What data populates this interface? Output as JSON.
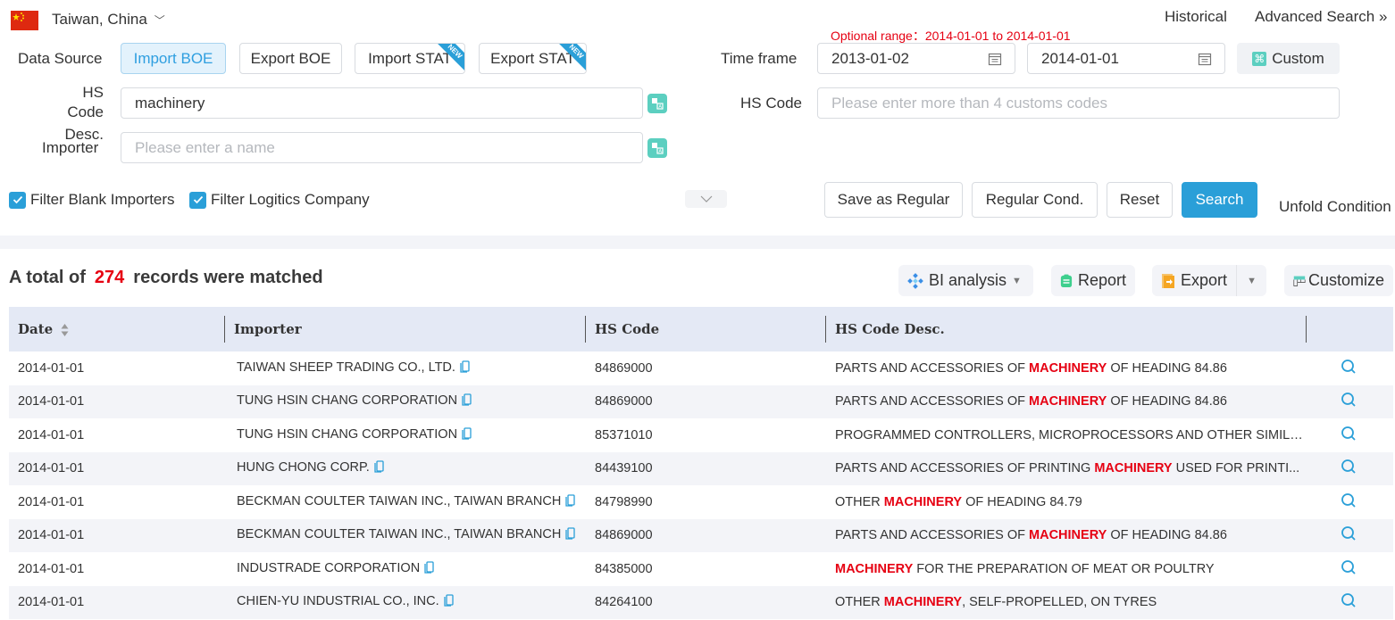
{
  "header": {
    "country": "Taiwan, China",
    "links": {
      "historical": "Historical",
      "advanced_search": "Advanced Search",
      "advanced_icon": "»"
    }
  },
  "form": {
    "data_source_label": "Data Source",
    "data_sources": [
      {
        "label": "Import BOE",
        "active": true,
        "new": false
      },
      {
        "label": "Export BOE",
        "active": false,
        "new": false
      },
      {
        "label": "Import STAT",
        "active": false,
        "new": true
      },
      {
        "label": "Export STAT",
        "active": false,
        "new": true
      }
    ],
    "new_badge": "NEW",
    "time_frame_label": "Time frame",
    "optional_range": "Optional range：2014-01-01 to 2014-01-01",
    "date_from": "2013-01-02",
    "date_to": "2014-01-01",
    "custom_label": "Custom",
    "hs_desc_label_1": "HS Code",
    "hs_desc_label_2": "Desc.",
    "hs_desc_value": "machinery",
    "hs_code_label": "HS Code",
    "hs_code_placeholder": "Please enter more than 4 customs codes",
    "importer_label": "Importer",
    "importer_placeholder": "Please enter a name",
    "filters": [
      {
        "label": "Filter Blank Importers",
        "checked": true
      },
      {
        "label": "Filter Logitics Company",
        "checked": true
      }
    ],
    "buttons": {
      "save_regular": "Save as Regular",
      "regular_cond": "Regular Cond.",
      "reset": "Reset",
      "search": "Search",
      "unfold": "Unfold Condition"
    }
  },
  "results": {
    "total_prefix": "A total of",
    "total_count": "274",
    "total_suffix": "records were matched",
    "tools": {
      "bi": "BI analysis",
      "report": "Report",
      "export": "Export",
      "customize": "Customize"
    },
    "columns": [
      "Date",
      "Importer",
      "HS Code",
      "HS Code Desc."
    ],
    "highlight_term": "MACHINERY",
    "rows": [
      {
        "date": "2014-01-01",
        "importer": "TAIWAN SHEEP TRADING CO., LTD.",
        "hs_code": "84869000",
        "desc": "PARTS AND ACCESSORIES OF MACHINERY OF HEADING 84.86"
      },
      {
        "date": "2014-01-01",
        "importer": "TUNG HSIN CHANG CORPORATION",
        "hs_code": "84869000",
        "desc": "PARTS AND ACCESSORIES OF MACHINERY OF HEADING 84.86"
      },
      {
        "date": "2014-01-01",
        "importer": "TUNG HSIN CHANG CORPORATION",
        "hs_code": "85371010",
        "desc": "PROGRAMMED CONTROLLERS, MICROPROCESSORS AND OTHER SIMILAR ..."
      },
      {
        "date": "2014-01-01",
        "importer": "HUNG CHONG CORP.",
        "hs_code": "84439100",
        "desc": "PARTS AND ACCESSORIES OF PRINTING MACHINERY USED FOR PRINTI..."
      },
      {
        "date": "2014-01-01",
        "importer": "BECKMAN COULTER TAIWAN INC., TAIWAN BRANCH",
        "hs_code": "84798990",
        "desc": "OTHER MACHINERY OF HEADING 84.79"
      },
      {
        "date": "2014-01-01",
        "importer": "BECKMAN COULTER TAIWAN INC., TAIWAN BRANCH",
        "hs_code": "84869000",
        "desc": "PARTS AND ACCESSORIES OF MACHINERY OF HEADING 84.86"
      },
      {
        "date": "2014-01-01",
        "importer": "INDUSTRADE CORPORATION",
        "hs_code": "84385000",
        "desc": "MACHINERY FOR THE PREPARATION OF MEAT OR POULTRY"
      },
      {
        "date": "2014-01-01",
        "importer": "CHIEN-YU INDUSTRIAL CO., INC.",
        "hs_code": "84264100",
        "desc": "OTHER MACHINERY, SELF-PROPELLED, ON TYRES"
      }
    ]
  },
  "colors": {
    "accent": "#2a9fd8",
    "highlight": "#e60012",
    "teal": "#5ccfc0"
  }
}
